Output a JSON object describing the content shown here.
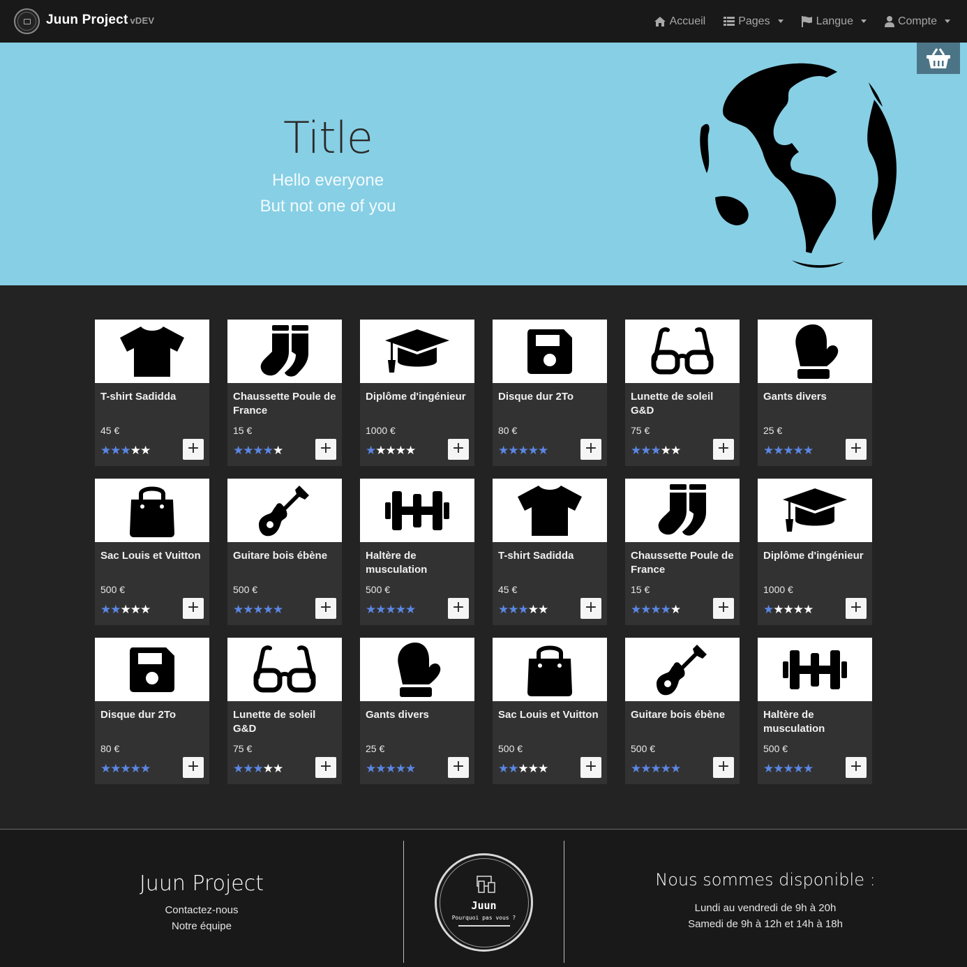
{
  "navbar": {
    "brand": "Juun Project",
    "version": "vDEV",
    "items": [
      {
        "label": "Accueil",
        "icon": "home-icon",
        "dropdown": false
      },
      {
        "label": "Pages",
        "icon": "table-icon",
        "dropdown": true
      },
      {
        "label": "Langue",
        "icon": "flag-icon",
        "dropdown": true
      },
      {
        "label": "Compte",
        "icon": "user-icon",
        "dropdown": true
      }
    ]
  },
  "hero": {
    "title": "Title",
    "subtitle_1": "Hello everyone",
    "subtitle_2": "But not one of you",
    "background": "#87cfe4",
    "cart_icon": "basket-icon"
  },
  "products": [
    {
      "name": "T-shirt Sadidda",
      "price": "45 €",
      "rating": 3,
      "icon": "tshirt-icon"
    },
    {
      "name": "Chaussette Poule de France",
      "price": "15 €",
      "rating": 3.5,
      "icon": "socks-icon"
    },
    {
      "name": "Diplôme d'ingénieur",
      "price": "1000 €",
      "rating": 0.5,
      "icon": "graduation-cap-icon"
    },
    {
      "name": "Disque dur 2To",
      "price": "80 €",
      "rating": 5,
      "icon": "floppy-disk-icon"
    },
    {
      "name": "Lunette de soleil G&D",
      "price": "75 €",
      "rating": 3,
      "icon": "glasses-icon"
    },
    {
      "name": "Gants divers",
      "price": "25 €",
      "rating": 4.5,
      "icon": "mitten-icon"
    },
    {
      "name": "Sac Louis et Vuitton",
      "price": "500 €",
      "rating": 2,
      "icon": "bag-icon"
    },
    {
      "name": "Guitare bois ébène",
      "price": "500 €",
      "rating": 4.5,
      "icon": "guitar-icon"
    },
    {
      "name": "Haltère de musculation",
      "price": "500 €",
      "rating": 4.5,
      "icon": "dumbbell-icon"
    },
    {
      "name": "T-shirt Sadidda",
      "price": "45 €",
      "rating": 3,
      "icon": "tshirt-icon"
    },
    {
      "name": "Chaussette Poule de France",
      "price": "15 €",
      "rating": 3.5,
      "icon": "socks-icon"
    },
    {
      "name": "Diplôme d'ingénieur",
      "price": "1000 €",
      "rating": 0.5,
      "icon": "graduation-cap-icon"
    },
    {
      "name": "Disque dur 2To",
      "price": "80 €",
      "rating": 5,
      "icon": "floppy-disk-icon"
    },
    {
      "name": "Lunette de soleil G&D",
      "price": "75 €",
      "rating": 3,
      "icon": "glasses-icon"
    },
    {
      "name": "Gants divers",
      "price": "25 €",
      "rating": 4.5,
      "icon": "mitten-icon"
    },
    {
      "name": "Sac Louis et Vuitton",
      "price": "500 €",
      "rating": 2,
      "icon": "bag-icon"
    },
    {
      "name": "Guitare bois ébène",
      "price": "500 €",
      "rating": 4.5,
      "icon": "guitar-icon"
    },
    {
      "name": "Haltère de musculation",
      "price": "500 €",
      "rating": 4.5,
      "icon": "dumbbell-icon"
    }
  ],
  "add_label": "+",
  "colors": {
    "star_on": "#5b86e5",
    "star_off": "#ffffff",
    "card_bg": "#323232"
  },
  "footer": {
    "title": "Juun Project",
    "links": [
      "Contactez-nous",
      "Notre équipe"
    ],
    "logo_name": "Juun",
    "logo_tagline": "Pourquoi pas vous ?",
    "availability_title": "Nous sommes disponible :",
    "hours": [
      "Lundi au vendredi de 9h à 20h",
      "Samedi de 9h à 12h et 14h à 18h"
    ]
  }
}
